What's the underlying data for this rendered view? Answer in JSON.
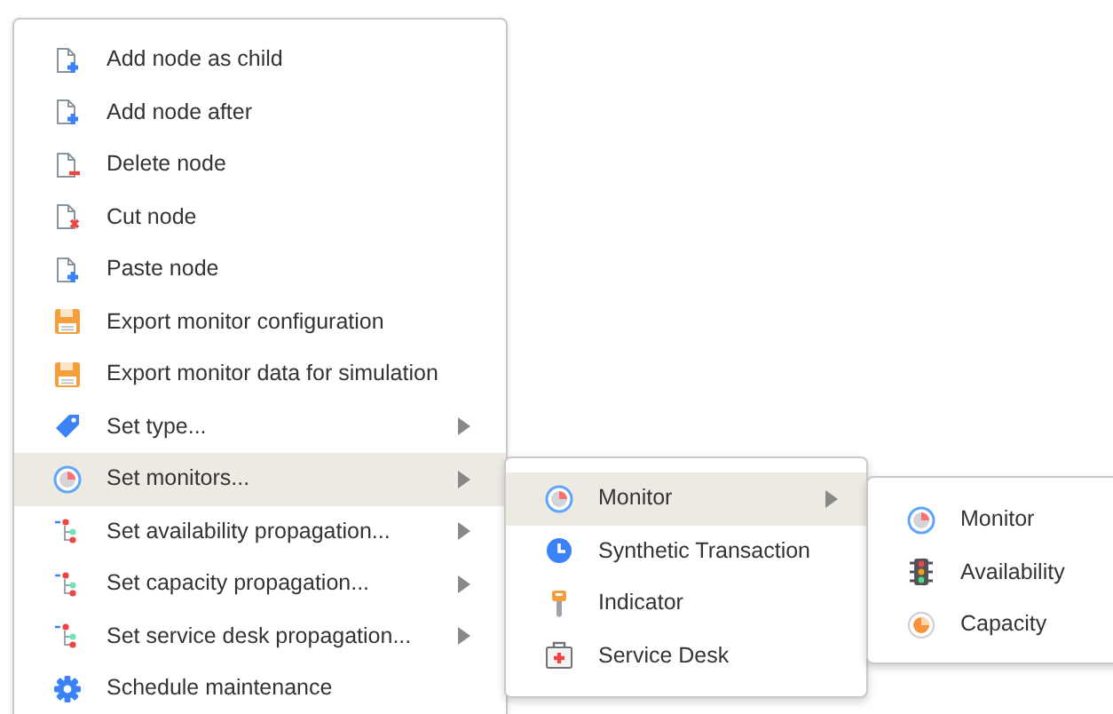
{
  "menu": {
    "items": [
      {
        "label": "Add node as child",
        "has_submenu": false,
        "selected": false
      },
      {
        "label": "Add node after",
        "has_submenu": false,
        "selected": false
      },
      {
        "label": "Delete node",
        "has_submenu": false,
        "selected": false
      },
      {
        "label": "Cut node",
        "has_submenu": false,
        "selected": false
      },
      {
        "label": "Paste node",
        "has_submenu": false,
        "selected": false
      },
      {
        "label": "Export monitor configuration",
        "has_submenu": false,
        "selected": false
      },
      {
        "label": "Export monitor data for simulation",
        "has_submenu": false,
        "selected": false
      },
      {
        "label": "Set type...",
        "has_submenu": true,
        "selected": false
      },
      {
        "label": "Set monitors...",
        "has_submenu": true,
        "selected": true
      },
      {
        "label": "Set availability propagation...",
        "has_submenu": true,
        "selected": false
      },
      {
        "label": "Set capacity propagation...",
        "has_submenu": true,
        "selected": false
      },
      {
        "label": "Set service desk propagation...",
        "has_submenu": true,
        "selected": false
      },
      {
        "label": "Schedule maintenance",
        "has_submenu": false,
        "selected": false
      }
    ]
  },
  "submenu": {
    "items": [
      {
        "label": "Monitor",
        "has_submenu": true,
        "selected": true
      },
      {
        "label": "Synthetic Transaction",
        "has_submenu": false,
        "selected": false
      },
      {
        "label": "Indicator",
        "has_submenu": false,
        "selected": false
      },
      {
        "label": "Service Desk",
        "has_submenu": false,
        "selected": false
      }
    ]
  },
  "nested_submenu": {
    "items": [
      {
        "label": "Monitor",
        "has_submenu": false,
        "selected": false
      },
      {
        "label": "Availability",
        "has_submenu": false,
        "selected": false
      },
      {
        "label": "Capacity",
        "has_submenu": false,
        "selected": false
      }
    ]
  }
}
